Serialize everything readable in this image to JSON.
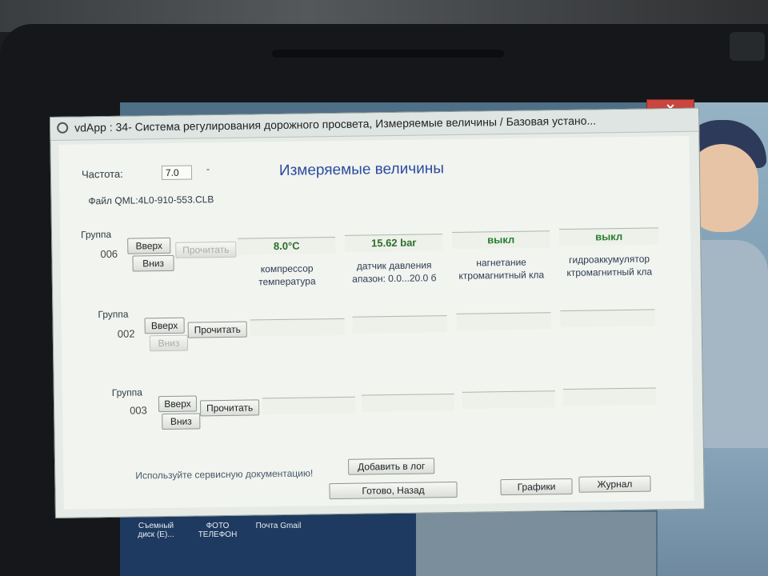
{
  "window": {
    "title": "vdApp : 34- Система регулирования дорожного просвета,  Измеряемые величины / Базовая устано...",
    "close_glyph": "✕"
  },
  "header": {
    "freq_label": "Частота:",
    "freq_value": "7.0",
    "freq_suffix": "-",
    "title": "Измеряемые величины",
    "file_label": "Файл QML:4L0-910-553.CLB"
  },
  "groups": [
    {
      "label": "Группа",
      "number": "006",
      "up": "Вверх",
      "down": "Вниз",
      "read": "Прочитать",
      "fields": [
        {
          "value": "8.0°C",
          "line1": "компрессор",
          "line2": "температура"
        },
        {
          "value": "15.62 bar",
          "line1": "датчик давления",
          "line2": "апазон: 0.0...20.0 б"
        },
        {
          "value": "выкл",
          "line1": "нагнетание",
          "line2": "ктромагнитный кла"
        },
        {
          "value": "выкл",
          "line1": "гидроаккумулятор",
          "line2": "ктромагнитный кла"
        }
      ]
    },
    {
      "label": "Группа",
      "number": "002",
      "up": "Вверх",
      "down": "Вниз",
      "read": "Прочитать"
    },
    {
      "label": "Группа",
      "number": "003",
      "up": "Вверх",
      "down": "Вниз",
      "read": "Прочитать"
    }
  ],
  "footer": {
    "hint": "Используйте сервисную документацию!",
    "add_log": "Добавить в лог",
    "done_back": "Готово, Назад",
    "graphs": "Графики",
    "journal": "Журнал"
  },
  "desktop": {
    "icons": [
      {
        "line1": "Съемный",
        "line2": "диск (E)..."
      },
      {
        "line1": "ФОТО",
        "line2": "ТЕЛЕФОН"
      },
      {
        "line1": "Почта Gmail",
        "line2": ""
      }
    ]
  }
}
